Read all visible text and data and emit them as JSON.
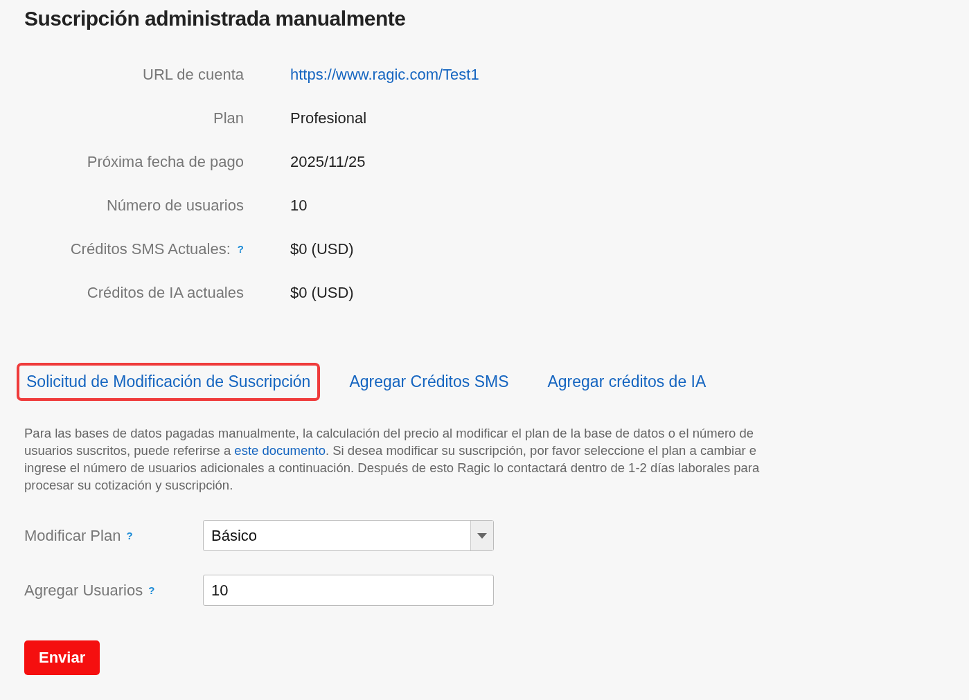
{
  "title": "Suscripción administrada manualmente",
  "details": [
    {
      "label": "URL de cuenta",
      "value": "https://www.ragic.com/Test1",
      "kind": "link"
    },
    {
      "label": "Plan",
      "value": "Profesional",
      "kind": "text"
    },
    {
      "label": "Próxima fecha de pago",
      "value": "2025/11/25",
      "kind": "text"
    },
    {
      "label": "Número de usuarios",
      "value": "10",
      "kind": "text"
    },
    {
      "label": "Créditos SMS Actuales:",
      "help": "?",
      "value": "$0 (USD)",
      "kind": "text"
    },
    {
      "label": "Créditos de IA actuales",
      "value": "$0 (USD)",
      "kind": "text"
    }
  ],
  "links": [
    {
      "label": "Solicitud de Modificación de Suscripción",
      "highlighted": true
    },
    {
      "label": "Agregar Créditos SMS",
      "highlighted": false
    },
    {
      "label": "Agregar créditos de IA",
      "highlighted": false
    }
  ],
  "description": {
    "before": "Para las bases de datos pagadas manualmente, la calculación del precio al modificar el plan de la base de datos o el número de usuarios suscritos, puede referirse a ",
    "link": "este documento",
    "after": ". Si desea modificar su suscripción, por favor seleccione el plan a cambiar e ingrese el número de usuarios adicionales a continuación. Después de esto Ragic lo contactará dentro de 1-2 días laborales para procesar su cotización y suscripción."
  },
  "form": [
    {
      "label": "Modificar Plan",
      "help": "?",
      "kind": "select",
      "value": "Básico"
    },
    {
      "label": "Agregar Usuarios",
      "help": "?",
      "kind": "input",
      "value": "10"
    }
  ],
  "submit": "Enviar"
}
